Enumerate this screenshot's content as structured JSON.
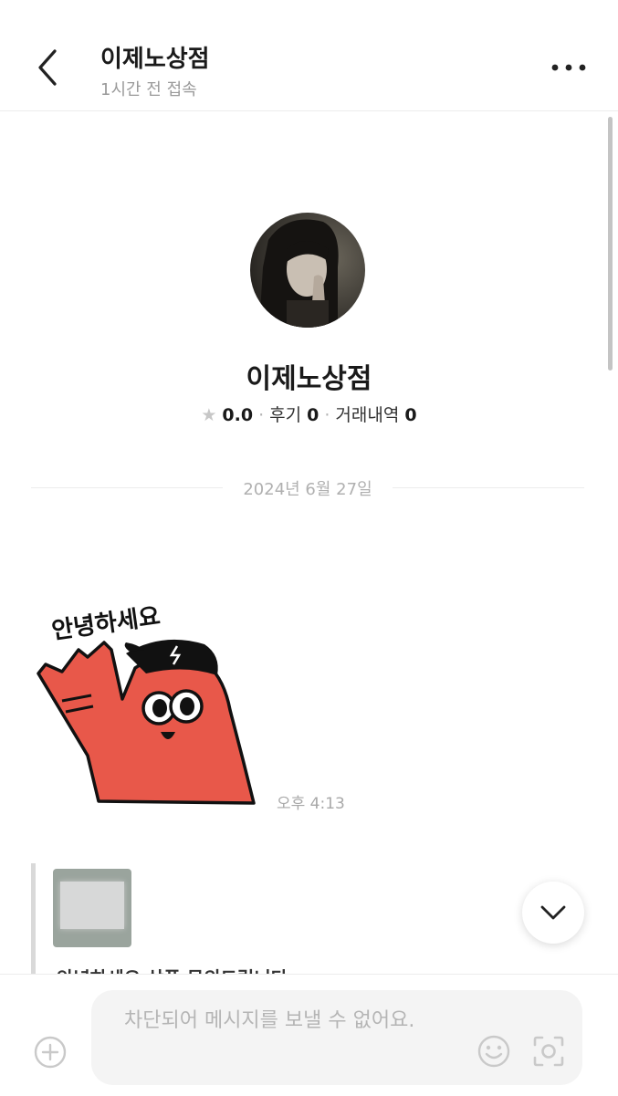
{
  "header": {
    "title": "이제노상점",
    "subtitle": "1시간 전 접속",
    "back_icon": "chevron-left-icon",
    "more_icon": "more-horizontal-icon"
  },
  "profile": {
    "name": "이제노상점",
    "rating_label": "0.0",
    "reviews_label": "후기",
    "reviews_count": "0",
    "history_label": "거래내역",
    "history_count": "0"
  },
  "chat": {
    "date_divider": "2024년 6월 27일",
    "sticker_text": "안녕하세요",
    "sticker_time": "오후 4:13",
    "quoted_text": "안녕하세요 상품 문의드립니다"
  },
  "composer": {
    "placeholder": "차단되어 메시지를 보낼 수 없어요.",
    "plus_icon": "plus-circle-icon",
    "emoji_icon": "emoji-icon",
    "camera_icon": "scan-camera-icon"
  },
  "colors": {
    "sticker_red": "#E8584A",
    "text_primary": "#1a1a1a",
    "text_muted": "#9a9a9a"
  }
}
